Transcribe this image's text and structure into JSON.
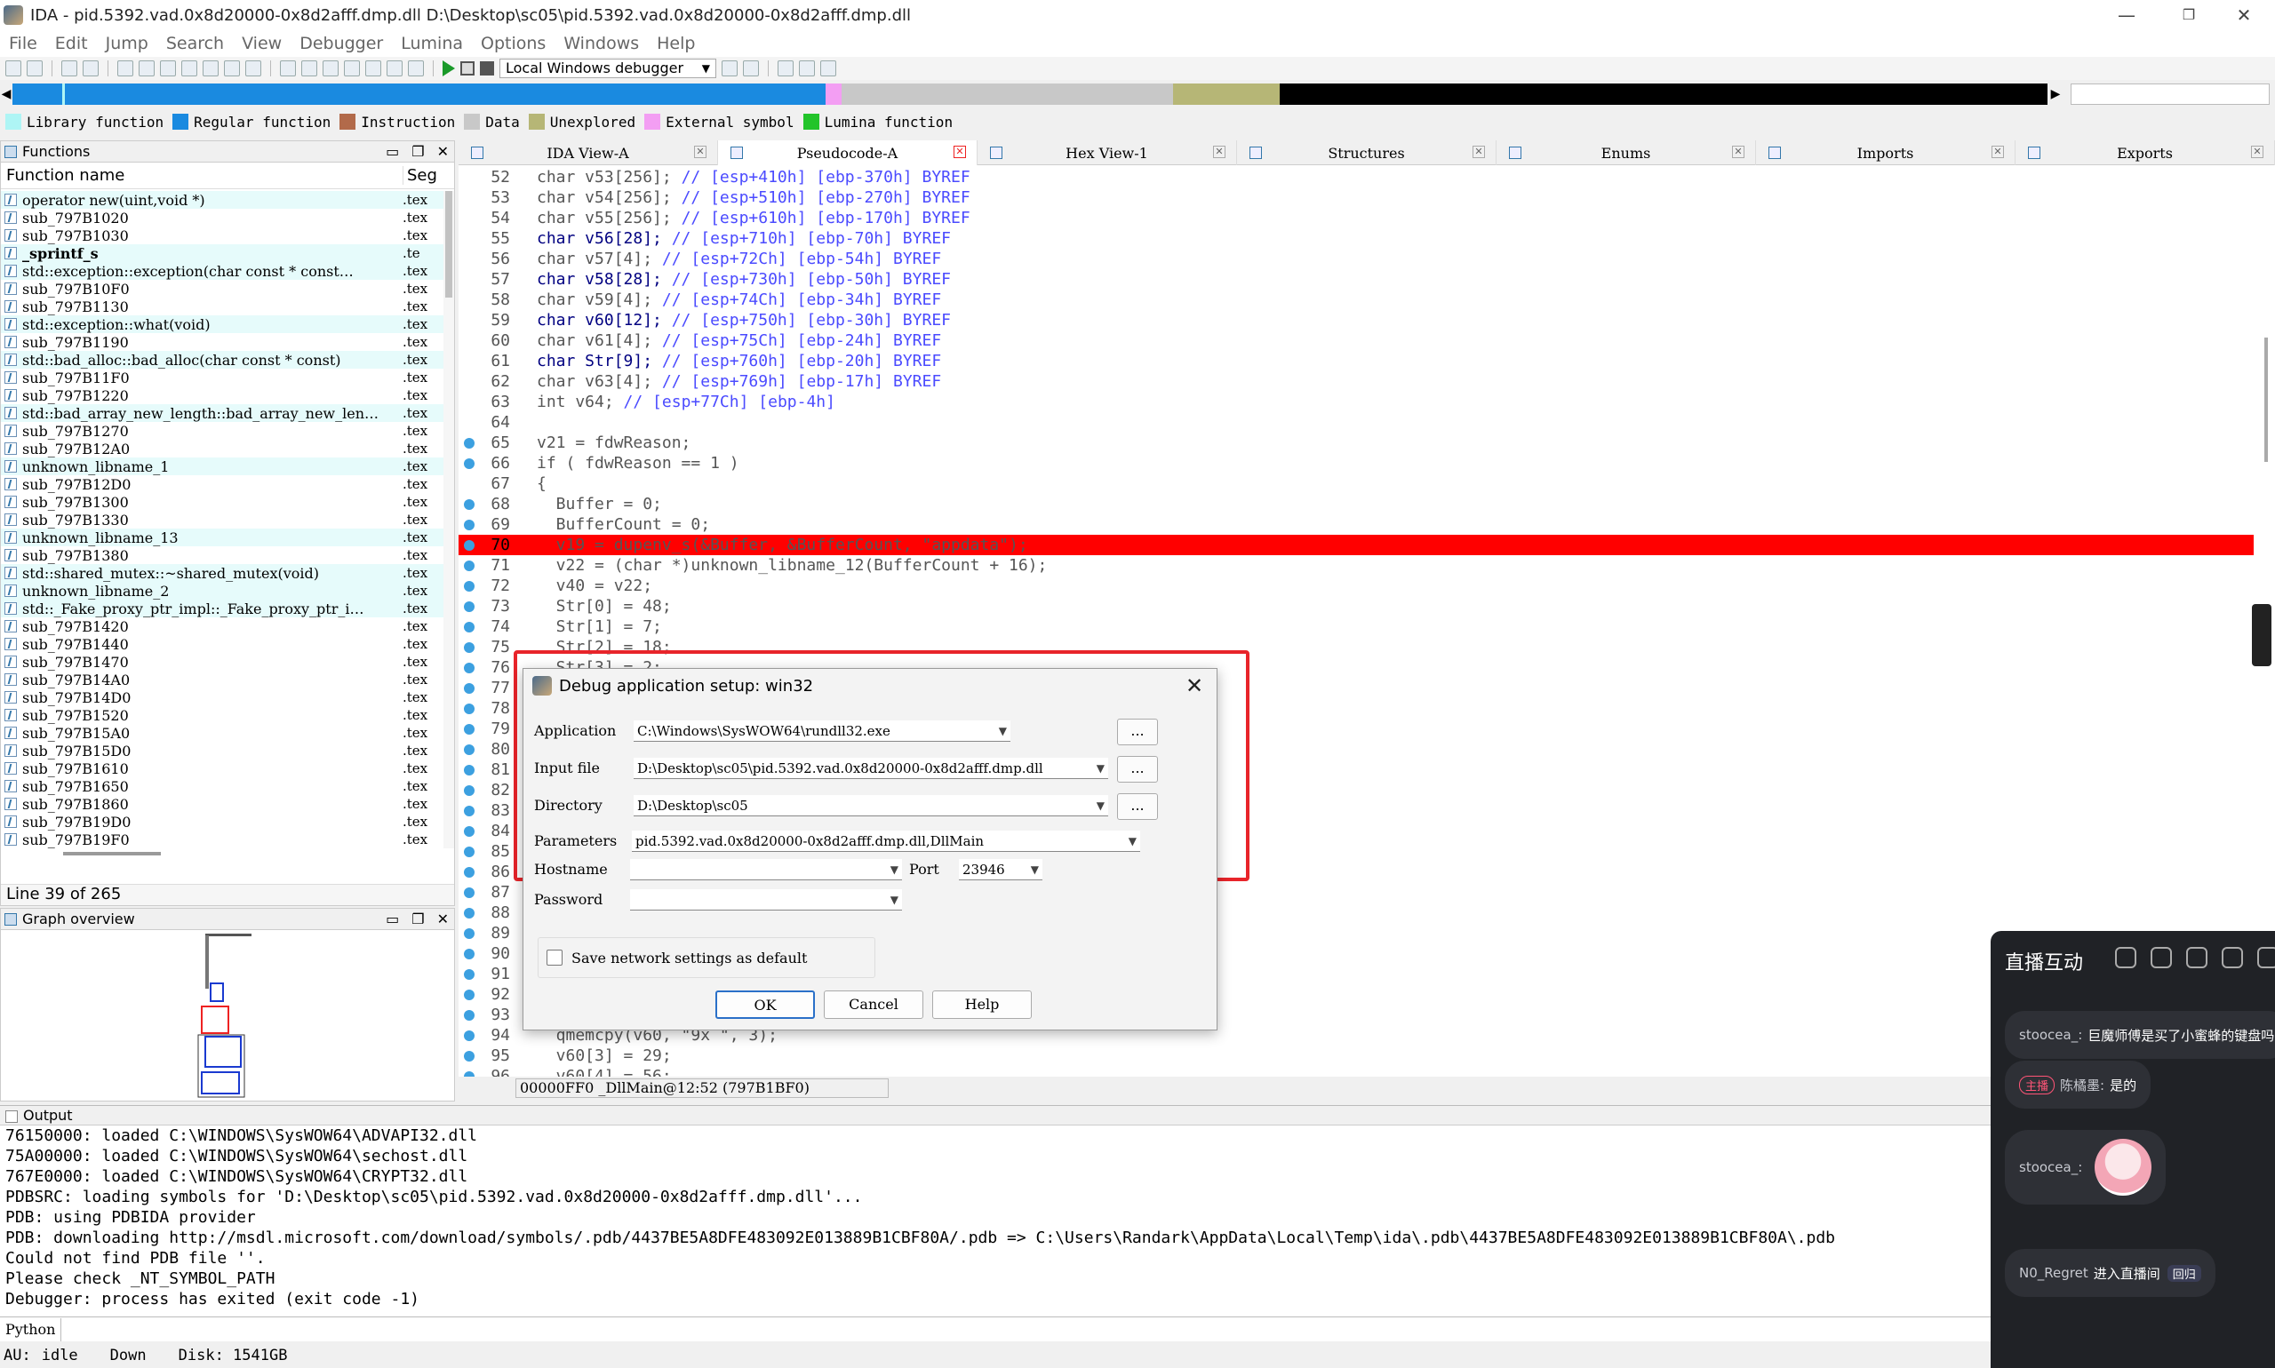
{
  "window": {
    "title": "IDA - pid.5392.vad.0x8d20000-0x8d2afff.dmp.dll D:\\Desktop\\sc05\\pid.5392.vad.0x8d20000-0x8d2afff.dmp.dll",
    "minimize": "—",
    "maximize": "❐",
    "close": "✕"
  },
  "menu": [
    "File",
    "Edit",
    "Jump",
    "Search",
    "View",
    "Debugger",
    "Lumina",
    "Options",
    "Windows",
    "Help"
  ],
  "toolbar": {
    "debugger": "Local Windows debugger"
  },
  "legend": [
    {
      "label": "Library function",
      "color": "#aef5f5"
    },
    {
      "label": "Regular function",
      "color": "#1a8ae0"
    },
    {
      "label": "Instruction",
      "color": "#b26a4a"
    },
    {
      "label": "Data",
      "color": "#c8c8c8"
    },
    {
      "label": "Unexplored",
      "color": "#b6b676"
    },
    {
      "label": "External symbol",
      "color": "#f39ef3"
    },
    {
      "label": "Lumina function",
      "color": "#22c42a"
    }
  ],
  "functions": {
    "title": "Functions",
    "col_name": "Function name",
    "col_seg": "Seg",
    "status": "Line 39 of 265",
    "items": [
      {
        "name": "operator new(uint,void *)",
        "seg": ".tex",
        "lib": true
      },
      {
        "name": "sub_797B1020",
        "seg": ".tex"
      },
      {
        "name": "sub_797B1030",
        "seg": ".tex"
      },
      {
        "name": "_sprintf_s",
        "seg": ".te",
        "lib": true,
        "bold": true
      },
      {
        "name": "std::exception::exception(char const * const…",
        "seg": ".tex",
        "lib": true
      },
      {
        "name": "sub_797B10F0",
        "seg": ".tex"
      },
      {
        "name": "sub_797B1130",
        "seg": ".tex"
      },
      {
        "name": "std::exception::what(void)",
        "seg": ".tex",
        "lib": true
      },
      {
        "name": "sub_797B1190",
        "seg": ".tex"
      },
      {
        "name": "std::bad_alloc::bad_alloc(char const * const)",
        "seg": ".tex",
        "lib": true
      },
      {
        "name": "sub_797B11F0",
        "seg": ".tex"
      },
      {
        "name": "sub_797B1220",
        "seg": ".tex"
      },
      {
        "name": "std::bad_array_new_length::bad_array_new_len…",
        "seg": ".tex",
        "lib": true
      },
      {
        "name": "sub_797B1270",
        "seg": ".tex"
      },
      {
        "name": "sub_797B12A0",
        "seg": ".tex"
      },
      {
        "name": "unknown_libname_1",
        "seg": ".tex",
        "lib": true
      },
      {
        "name": "sub_797B12D0",
        "seg": ".tex"
      },
      {
        "name": "sub_797B1300",
        "seg": ".tex"
      },
      {
        "name": "sub_797B1330",
        "seg": ".tex"
      },
      {
        "name": "unknown_libname_13",
        "seg": ".tex",
        "lib": true
      },
      {
        "name": "sub_797B1380",
        "seg": ".tex"
      },
      {
        "name": "std::shared_mutex::~shared_mutex(void)",
        "seg": ".tex",
        "lib": true
      },
      {
        "name": "unknown_libname_2",
        "seg": ".tex",
        "lib": true
      },
      {
        "name": "std::_Fake_proxy_ptr_impl::_Fake_proxy_ptr_i…",
        "seg": ".tex",
        "lib": true
      },
      {
        "name": "sub_797B1420",
        "seg": ".tex"
      },
      {
        "name": "sub_797B1440",
        "seg": ".tex"
      },
      {
        "name": "sub_797B1470",
        "seg": ".tex"
      },
      {
        "name": "sub_797B14A0",
        "seg": ".tex"
      },
      {
        "name": "sub_797B14D0",
        "seg": ".tex"
      },
      {
        "name": "sub_797B1520",
        "seg": ".tex"
      },
      {
        "name": "sub_797B15A0",
        "seg": ".tex"
      },
      {
        "name": "sub_797B15D0",
        "seg": ".tex"
      },
      {
        "name": "sub_797B1610",
        "seg": ".tex"
      },
      {
        "name": "sub_797B1650",
        "seg": ".tex"
      },
      {
        "name": "sub_797B1860",
        "seg": ".tex"
      },
      {
        "name": "sub_797B19D0",
        "seg": ".tex"
      },
      {
        "name": "sub_797B19F0",
        "seg": ".tex"
      }
    ]
  },
  "graph": {
    "title": "Graph overview"
  },
  "tabs": [
    {
      "label": "IDA View-A"
    },
    {
      "label": "Pseudocode-A",
      "active": true
    },
    {
      "label": "Hex View-1"
    },
    {
      "label": "Structures"
    },
    {
      "label": "Enums"
    },
    {
      "label": "Imports"
    },
    {
      "label": "Exports"
    }
  ],
  "code": [
    {
      "ln": "52",
      "text": "char v53[256]; ",
      "cmt": "// [esp+410h] [ebp-370h] BYREF",
      "kw": false
    },
    {
      "ln": "53",
      "text": "char v54[256]; ",
      "cmt": "// [esp+510h] [ebp-270h] BYREF",
      "kw": false
    },
    {
      "ln": "54",
      "text": "char v55[256]; ",
      "cmt": "// [esp+610h] [ebp-170h] BYREF",
      "kw": false
    },
    {
      "ln": "55",
      "text": "char v56[28]; ",
      "cmt": "// [esp+710h] [ebp-70h] BYREF",
      "kw": true
    },
    {
      "ln": "56",
      "text": "char v57[4]; ",
      "cmt": "// [esp+72Ch] [ebp-54h] BYREF",
      "kw": false
    },
    {
      "ln": "57",
      "text": "char v58[28]; ",
      "cmt": "// [esp+730h] [ebp-50h] BYREF",
      "kw": true
    },
    {
      "ln": "58",
      "text": "char v59[4]; ",
      "cmt": "// [esp+74Ch] [ebp-34h] BYREF",
      "kw": false
    },
    {
      "ln": "59",
      "text": "char v60[12]; ",
      "cmt": "// [esp+750h] [ebp-30h] BYREF",
      "kw": true
    },
    {
      "ln": "60",
      "text": "char v61[4]; ",
      "cmt": "// [esp+75Ch] [ebp-24h] BYREF",
      "kw": false
    },
    {
      "ln": "61",
      "text": "char Str[9]; ",
      "cmt": "// [esp+760h] [ebp-20h] BYREF",
      "kw": true
    },
    {
      "ln": "62",
      "text": "char v63[4]; ",
      "cmt": "// [esp+769h] [ebp-17h] BYREF",
      "kw": false
    },
    {
      "ln": "63",
      "text": "int v64; ",
      "cmt": "// [esp+77Ch] [ebp-4h]",
      "kw": false
    },
    {
      "ln": "64",
      "text": "",
      "cmt": ""
    },
    {
      "ln": "65",
      "text": "v21 = fdwReason;",
      "cmt": "",
      "dot": true
    },
    {
      "ln": "66",
      "text": "if ( fdwReason == 1 )",
      "cmt": "",
      "dot": true
    },
    {
      "ln": "67",
      "text": "{",
      "cmt": ""
    },
    {
      "ln": "68",
      "text": "  Buffer = 0;",
      "cmt": "",
      "dot": true
    },
    {
      "ln": "69",
      "text": "  BufferCount = 0;",
      "cmt": "",
      "dot": true
    },
    {
      "ln": "70",
      "text": "  v19 = dupenv_s(&Buffer, &BufferCount, \"appdata\");",
      "cmt": "",
      "dot": true,
      "hl": true
    },
    {
      "ln": "71",
      "text": "  v22 = (char *)unknown_libname_12(BufferCount + 16);",
      "cmt": "",
      "dot": true
    },
    {
      "ln": "72",
      "text": "  v40 = v22;",
      "cmt": "",
      "dot": true
    },
    {
      "ln": "73",
      "text": "  Str[0] = 48;",
      "cmt": "",
      "dot": true
    },
    {
      "ln": "74",
      "text": "  Str[1] = 7;",
      "cmt": "",
      "dot": true
    },
    {
      "ln": "75",
      "text": "  Str[2] = 18;",
      "cmt": "",
      "dot": true
    },
    {
      "ln": "76",
      "text": "  Str[3] = 2;",
      "cmt": "",
      "dot": true
    },
    {
      "ln": "77",
      "text": "",
      "cmt": "",
      "dot": true
    },
    {
      "ln": "78",
      "text": "",
      "cmt": "",
      "dot": true
    },
    {
      "ln": "79",
      "text": "",
      "cmt": "",
      "dot": true
    },
    {
      "ln": "80",
      "text": "",
      "cmt": "",
      "dot": true
    },
    {
      "ln": "81",
      "text": "",
      "cmt": "",
      "dot": true
    },
    {
      "ln": "82",
      "text": "",
      "cmt": "",
      "dot": true
    },
    {
      "ln": "83",
      "text": "",
      "cmt": "",
      "dot": true
    },
    {
      "ln": "84",
      "text": "",
      "cmt": "",
      "dot": true
    },
    {
      "ln": "85",
      "text": "",
      "cmt": "",
      "dot": true
    },
    {
      "ln": "86",
      "text": "",
      "cmt": "",
      "dot": true
    },
    {
      "ln": "87",
      "text": "",
      "cmt": "",
      "dot": true
    },
    {
      "ln": "88",
      "text": "",
      "cmt": "",
      "dot": true
    },
    {
      "ln": "89",
      "text": "",
      "cmt": "",
      "dot": true
    },
    {
      "ln": "90",
      "text": "",
      "cmt": "",
      "dot": true
    },
    {
      "ln": "91",
      "text": "",
      "cmt": "",
      "dot": true
    },
    {
      "ln": "92",
      "text": "",
      "cmt": "",
      "dot": true
    },
    {
      "ln": "93",
      "text": "",
      "cmt": "",
      "dot": true
    },
    {
      "ln": "94",
      "text": "  qmemcpy(v60, \"9x \", 3);",
      "cmt": "",
      "dot": true
    },
    {
      "ln": "95",
      "text": "  v60[3] = 29;",
      "cmt": "",
      "dot": true
    },
    {
      "ln": "96",
      "text": "  v60[4] = 56;",
      "cmt": "",
      "dot": true
    }
  ],
  "code_address": "00000FF0 _DllMain@12:52 (797B1BF0)",
  "output": {
    "title": "Output",
    "lines": [
      "76150000: loaded C:\\WINDOWS\\SysWOW64\\ADVAPI32.dll",
      "75A00000: loaded C:\\WINDOWS\\SysWOW64\\sechost.dll",
      "767E0000: loaded C:\\WINDOWS\\SysWOW64\\CRYPT32.dll",
      "PDBSRC: loading symbols for 'D:\\Desktop\\sc05\\pid.5392.vad.0x8d20000-0x8d2afff.dmp.dll'...",
      "PDB: using PDBIDA provider",
      "PDB: downloading http://msdl.microsoft.com/download/symbols/.pdb/4437BE5A8DFE483092E013889B1CBF80A/.pdb => C:\\Users\\Randark\\AppData\\Local\\Temp\\ida\\.pdb\\4437BE5A8DFE483092E013889B1CBF80A\\.pdb",
      "Could not find PDB file ''.",
      "Please check _NT_SYMBOL_PATH",
      "Debugger: process has exited (exit code -1)"
    ]
  },
  "python": {
    "label": "Python"
  },
  "status": {
    "au": "AU:",
    "state": "idle",
    "dir": "Down",
    "disk": "Disk: 1541GB"
  },
  "dialog": {
    "title": "Debug application setup: win32",
    "close": "✕",
    "application_label": "Application",
    "application_value": "C:\\Windows\\SysWOW64\\rundll32.exe",
    "input_label": "Input file",
    "input_value": "D:\\Desktop\\sc05\\pid.5392.vad.0x8d20000-0x8d2afff.dmp.dll",
    "directory_label": "Directory",
    "directory_value": "D:\\Desktop\\sc05",
    "parameters_label": "Parameters",
    "parameters_value": "pid.5392.vad.0x8d20000-0x8d2afff.dmp.dll,DllMain",
    "hostname_label": "Hostname",
    "hostname_value": "",
    "port_label": "Port",
    "port_value": "23946",
    "password_label": "Password",
    "password_value": "",
    "save_label": "Save network settings as default",
    "browse": "...",
    "ok": "OK",
    "cancel": "Cancel",
    "help": "Help"
  },
  "chat": {
    "title": "直播互动",
    "messages": [
      {
        "user": "stoocea_:",
        "text": "巨魔师傅是买了小蜜蜂的键盘吗"
      },
      {
        "badge": "主播",
        "user": "陈橘墨:",
        "text": "是的"
      },
      {
        "user": "stoocea_:",
        "sticker": true
      },
      {
        "user": "N0_Regret",
        "text": "进入直播间",
        "badge2": "回归"
      }
    ]
  }
}
